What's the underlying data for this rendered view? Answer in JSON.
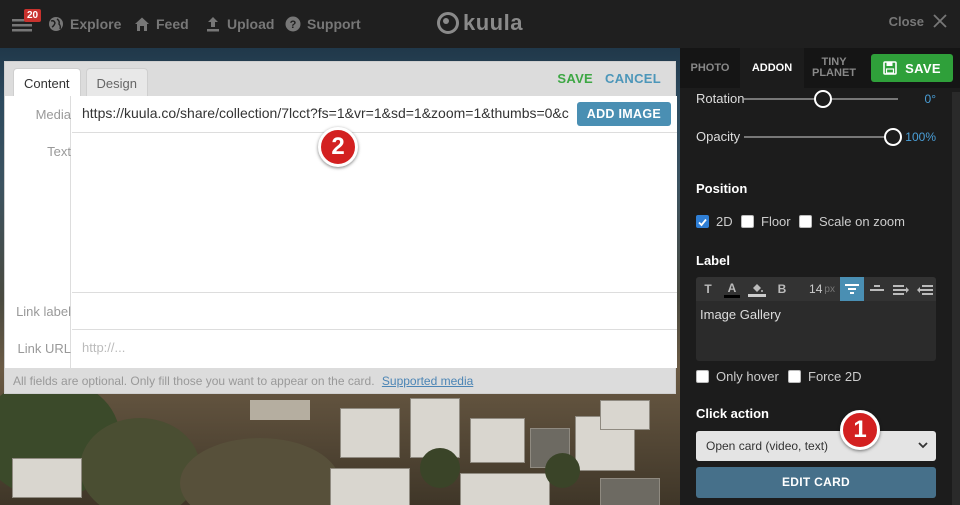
{
  "topbar": {
    "notification_count": "20",
    "nav": [
      {
        "label": "Explore",
        "icon": "globe-icon"
      },
      {
        "label": "Feed",
        "icon": "home-icon"
      },
      {
        "label": "Upload",
        "icon": "upload-icon"
      },
      {
        "label": "Support",
        "icon": "question-icon"
      }
    ],
    "logo": "kuula",
    "close_label": "Close"
  },
  "editor": {
    "tabs": [
      "Content",
      "Design"
    ],
    "active_tab": "Content",
    "save_label": "SAVE",
    "cancel_label": "CANCEL",
    "fields": {
      "media_label": "Media",
      "media_value": "https://kuula.co/share/collection/7lcct?fs=1&vr=1&sd=1&zoom=1&thumbs=0&c",
      "add_image_label": "ADD IMAGE",
      "text_label": "Text",
      "link_label_label": "Link label",
      "link_url_label": "Link URL",
      "link_url_placeholder": "http://..."
    },
    "footnote": "All fields are optional. Only fill those you want to appear on the card.",
    "footnote_link": "Supported media"
  },
  "markers": {
    "one": "1",
    "two": "2"
  },
  "panel": {
    "tabs": [
      "PHOTO",
      "ADDON",
      "TINY PLANET"
    ],
    "active_tab": "ADDON",
    "save_label": "SAVE",
    "rotation_label": "Rotation",
    "rotation_value": "0°",
    "opacity_label": "Opacity",
    "opacity_value": "100%",
    "opacity_level": 1.0,
    "position_title": "Position",
    "position_options": [
      {
        "label": "2D",
        "checked": true
      },
      {
        "label": "Floor",
        "checked": false
      },
      {
        "label": "Scale on zoom",
        "checked": false
      }
    ],
    "label_title": "Label",
    "font_size": "14",
    "font_unit": "px",
    "label_text": "Image Gallery",
    "label_options": [
      {
        "label": "Only hover",
        "checked": false
      },
      {
        "label": "Force 2D",
        "checked": false
      }
    ],
    "click_action_title": "Click action",
    "click_action_value": "Open card (video, text)",
    "edit_card_label": "EDIT CARD"
  },
  "colors": {
    "accent_green": "#2fa03a",
    "accent_blue": "#4a8fb3",
    "marker_red": "#d32020",
    "checkbox_blue": "#2f7fd6"
  }
}
